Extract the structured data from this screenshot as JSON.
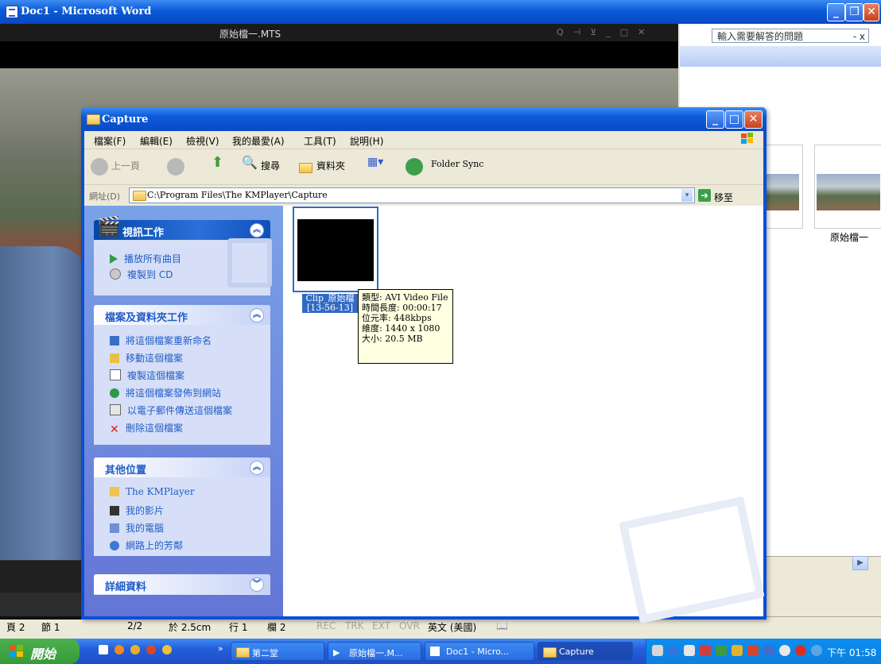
{
  "word": {
    "title": "Doc1 - Microsoft Word",
    "help_placeholder": "輸入需要解答的問題",
    "help_close": "- x",
    "thumb_label": "原始檔一",
    "status": {
      "page": "頁 2",
      "section": "節 1",
      "page_of": "2/2",
      "at": "於 2.5cm",
      "line": "行 1",
      "col": "欄 2",
      "rec": "REC",
      "trk": "TRK",
      "ext": "EXT",
      "ovr": "OVR",
      "lang": "英文 (美國)"
    }
  },
  "kmplayer": {
    "title": "原始檔一.MTS"
  },
  "capture": {
    "title": "Capture",
    "menu": [
      "檔案(F)",
      "編輯(E)",
      "檢視(V)",
      "我的最愛(A)",
      "工具(T)",
      "說明(H)"
    ],
    "toolbar": {
      "back": "上一頁",
      "search": "搜尋",
      "folders": "資料夾",
      "folder_sync": "Folder Sync"
    },
    "address_label": "網址(D)",
    "address": "C:\\Program Files\\The KMPlayer\\Capture",
    "go": "移至",
    "panels": {
      "video_tasks": {
        "title": "視訊工作",
        "items": [
          "播放所有曲目",
          "複製到 CD"
        ]
      },
      "file_tasks": {
        "title": "檔案及資料夾工作",
        "items": [
          "將這個檔案重新命名",
          "移動這個檔案",
          "複製這個檔案",
          "將這個檔案發佈到網站",
          "以電子郵件傳送這個檔案",
          "刪除這個檔案"
        ]
      },
      "other_places": {
        "title": "其他位置",
        "items": [
          "The KMPlayer",
          "我的影片",
          "我的電腦",
          "網路上的芳鄰"
        ]
      },
      "details": {
        "title": "詳細資料"
      }
    },
    "file": {
      "label_line1": "Clip_原始檔",
      "label_line2": "[13-56-13]"
    },
    "tooltip": {
      "type": "類型: AVI Video File",
      "duration": "時間長度: 00:00:17",
      "bitrate": "位元率: 448kbps",
      "dimensions": "維度: 1440 x 1080",
      "size": "大小: 20.5 MB"
    }
  },
  "taskbar": {
    "start": "開始",
    "tasks": [
      "第二堂",
      "原始檔一.M...",
      "Doc1 - Micro...",
      "Capture"
    ],
    "clock": "下午 01:58"
  }
}
